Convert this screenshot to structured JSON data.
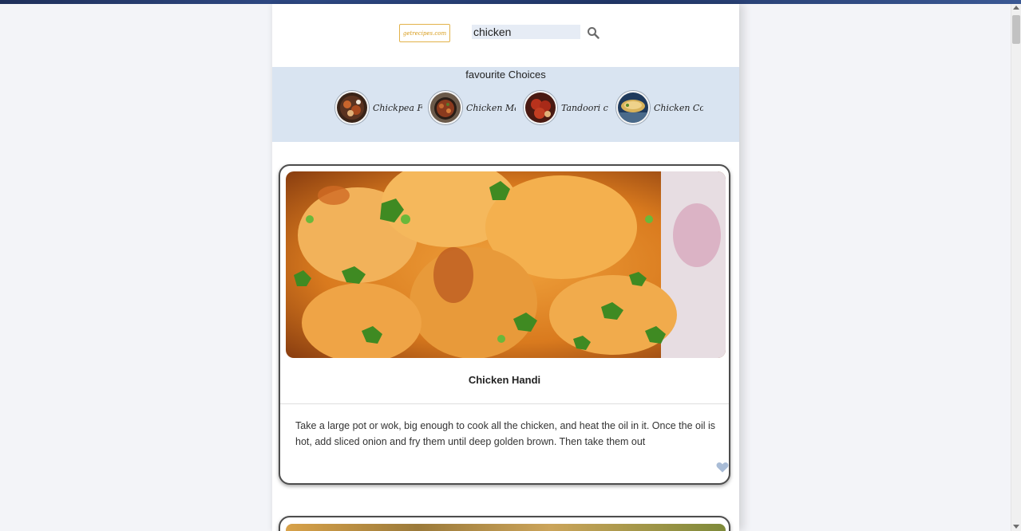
{
  "header": {
    "logo_text": "getrecipes.com",
    "search": {
      "value": "chicken",
      "placeholder": ""
    },
    "search_icon": "search-icon"
  },
  "favourites": {
    "title": "favourite Choices",
    "items": [
      {
        "label": "Chickpea F"
      },
      {
        "label": "Chicken Ma"
      },
      {
        "label": "Tandoori c"
      },
      {
        "label": "Chicken Co"
      }
    ]
  },
  "recipes": [
    {
      "title": "Chicken Handi",
      "description": "Take a large pot or wok, big enough to cook all the chicken, and heat the oil in it. Once the oil is hot, add sliced onion and fry them until deep golden brown. Then take them out",
      "favourite_icon": "heart-icon"
    }
  ],
  "colors": {
    "accent": "#d89c1c",
    "favourites_bg": "#d9e4f1",
    "heart": "#a9bcd6"
  }
}
